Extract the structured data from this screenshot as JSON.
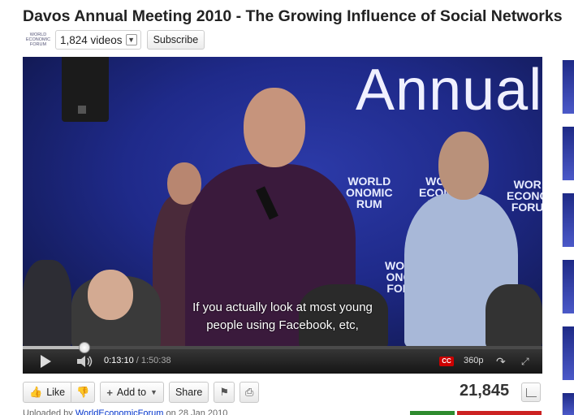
{
  "video": {
    "title": "Davos Annual Meeting 2010 - The Growing Influence of Social Networks",
    "subtitle_line1": "If you actually look at most young",
    "subtitle_line2": "people using Facebook, etc,",
    "background_word": "Annual"
  },
  "channel": {
    "logo_line1": "WORLD",
    "logo_line2": "ECONOMIC",
    "logo_line3": "FORUM",
    "videos_count": "1,824 videos",
    "subscribe_label": "Subscribe"
  },
  "player": {
    "current_time": "0:13:10",
    "separator": " / ",
    "duration": "1:50:38",
    "progress_fraction": 0.119,
    "cc_label": "CC",
    "quality": "360p",
    "icons": [
      "play-icon",
      "volume-icon",
      "popout-icon",
      "fullscreen-icon"
    ]
  },
  "actions": {
    "like_label": "Like",
    "add_to_label": "Add to",
    "share_label": "Share",
    "icons": [
      "thumbs-up-icon",
      "thumbs-down-icon",
      "plus-icon",
      "chevron-down-icon",
      "flag-icon",
      "print-icon"
    ]
  },
  "stats": {
    "views": "21,845"
  },
  "uploader": {
    "prefix": "Uploaded by ",
    "name": "WorldEconomicForum",
    "date": " on 28 Jan 2010"
  },
  "colors": {
    "accent_link": "#0033cc",
    "cc_red": "#cc0000",
    "like_green": "#2e8b2e",
    "dislike_red": "#cc2222"
  }
}
